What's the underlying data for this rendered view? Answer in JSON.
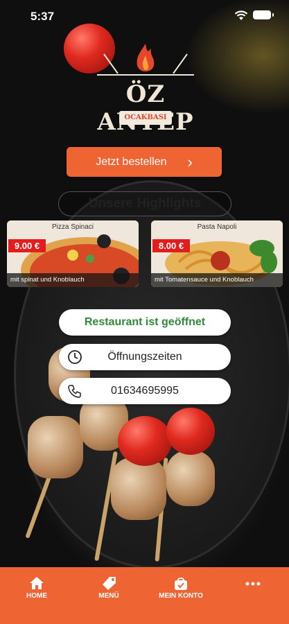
{
  "status_bar": {
    "time": "5:37"
  },
  "logo": {
    "title": "ÖZ ANTEP",
    "subtitle": "OCAKBASI"
  },
  "order_button": {
    "label": "Jetzt bestellen",
    "icon": "chevron-right-icon"
  },
  "highlights": {
    "title": "Unsere Highlights",
    "items": [
      {
        "name": "Pizza Spinaci",
        "price": "9.00 €",
        "description": "mit spinat und Knoblauch"
      },
      {
        "name": "Pasta Napoli",
        "price": "8.00 €",
        "description": "mit Tomatensauce und Knoblauch"
      }
    ]
  },
  "info": {
    "status": "Restaurant ist geöffnet",
    "hours_label": "Öffnungszeiten",
    "phone": "01634695995"
  },
  "tabbar": {
    "items": [
      {
        "label": "HOME",
        "icon": "home-icon"
      },
      {
        "label": "MENÜ",
        "icon": "tag-icon"
      },
      {
        "label": "MEIN KONTO",
        "icon": "bag-icon"
      },
      {
        "label": "",
        "icon": "more-icon"
      }
    ]
  },
  "colors": {
    "accent": "#ee6533",
    "open_status": "#2f8a3a",
    "price_badge": "#e11d1d"
  }
}
